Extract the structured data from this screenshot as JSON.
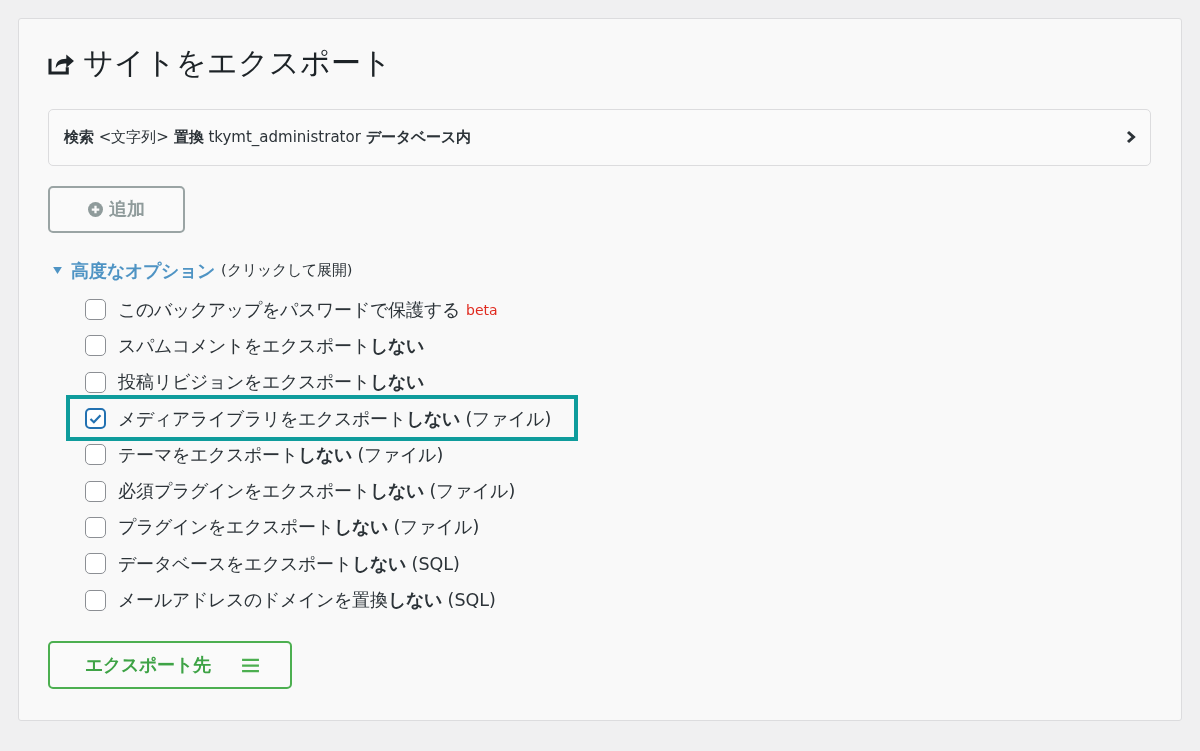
{
  "title": "サイトをエクスポート",
  "find_replace": {
    "summary": "**検索** <文字列> **置換** tkymt_administrator **データベース内**"
  },
  "add_button": {
    "label": "追加"
  },
  "advanced": {
    "title": "高度なオプション",
    "hint": "(クリックして展開)",
    "expanded": true
  },
  "options": [
    {
      "label": "このバックアップをパスワードで保護する",
      "badge": "beta",
      "checked": false,
      "highlighted": false
    },
    {
      "label": "スパムコメントをエクスポート**しない**",
      "checked": false,
      "highlighted": false
    },
    {
      "label": "投稿リビジョンをエクスポート**しない**",
      "checked": false,
      "highlighted": false
    },
    {
      "label": "メディアライブラリをエクスポート**しない** (ファイル)",
      "checked": true,
      "highlighted": true
    },
    {
      "label": "テーマをエクスポート**しない** (ファイル)",
      "checked": false,
      "highlighted": false
    },
    {
      "label": "必須プラグインをエクスポート**しない** (ファイル)",
      "checked": false,
      "highlighted": false
    },
    {
      "label": "プラグインをエクスポート**しない** (ファイル)",
      "checked": false,
      "highlighted": false
    },
    {
      "label": "データベースをエクスポート**しない** (SQL)",
      "checked": false,
      "highlighted": false
    },
    {
      "label": "メールアドレスのドメインを置換**しない** (SQL)",
      "checked": false,
      "highlighted": false
    }
  ],
  "export_button": {
    "label": "エクスポート先"
  }
}
